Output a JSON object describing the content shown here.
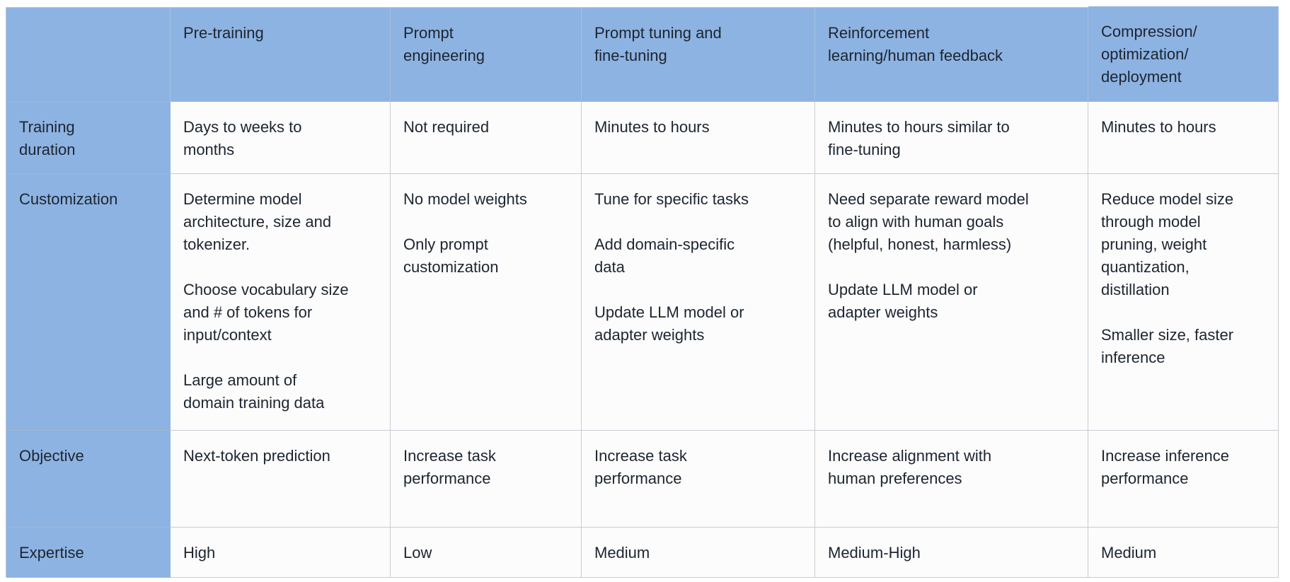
{
  "table": {
    "corner_label": "",
    "columns": [
      "Pre-training",
      "Prompt engineering",
      "Prompt tuning and fine-tuning",
      "Reinforcement learning/human feedback",
      "Compression/ optimization/ deployment"
    ],
    "column_lines": [
      [
        "Pre-training"
      ],
      [
        "Prompt",
        "engineering"
      ],
      [
        "Prompt tuning and",
        "fine-tuning"
      ],
      [
        "Reinforcement",
        "learning/human feedback"
      ],
      [
        "Compression/",
        "optimization/",
        "deployment"
      ]
    ],
    "rows": [
      {
        "label": "Training duration",
        "label_lines": [
          "Training",
          "duration"
        ],
        "cells": [
          [
            [
              "Days to weeks to",
              "months"
            ]
          ],
          [
            [
              "Not required"
            ]
          ],
          [
            [
              "Minutes to hours"
            ]
          ],
          [
            [
              "Minutes to hours similar to",
              "fine-tuning"
            ]
          ],
          [
            [
              "Minutes to hours"
            ]
          ]
        ]
      },
      {
        "label": "Customization",
        "label_lines": [
          "Customization"
        ],
        "cells": [
          [
            [
              "Determine model",
              "architecture, size and",
              "tokenizer."
            ],
            [
              "Choose vocabulary size",
              "and # of tokens for",
              "input/context"
            ],
            [
              "Large amount of",
              "domain training data"
            ]
          ],
          [
            [
              "No model weights"
            ],
            [
              "Only prompt",
              "customization"
            ]
          ],
          [
            [
              "Tune for specific tasks"
            ],
            [
              "Add domain-specific",
              "data"
            ],
            [
              "Update LLM model or",
              "adapter weights"
            ]
          ],
          [
            [
              "Need separate reward model",
              "to align with human goals",
              "(helpful, honest, harmless)"
            ],
            [
              "Update LLM model or",
              "adapter weights"
            ]
          ],
          [
            [
              "Reduce model size",
              "through model",
              "pruning, weight",
              "quantization,",
              "distillation"
            ],
            [
              "Smaller size, faster",
              "inference"
            ]
          ]
        ]
      },
      {
        "label": "Objective",
        "label_lines": [
          "Objective"
        ],
        "cells": [
          [
            [
              "Next-token prediction"
            ]
          ],
          [
            [
              "Increase task",
              "performance"
            ]
          ],
          [
            [
              "Increase task",
              "performance"
            ]
          ],
          [
            [
              "Increase alignment with",
              "human preferences"
            ]
          ],
          [
            [
              "Increase inference",
              "performance"
            ]
          ]
        ]
      },
      {
        "label": "Expertise",
        "label_lines": [
          "Expertise"
        ],
        "cells": [
          [
            [
              "High"
            ]
          ],
          [
            [
              "Low"
            ]
          ],
          [
            [
              "Medium"
            ]
          ],
          [
            [
              "Medium-High"
            ]
          ],
          [
            [
              "Medium"
            ]
          ]
        ]
      }
    ]
  },
  "colors": {
    "header_bg": "#8db3e2",
    "cell_bg": "#fdfcfc",
    "text": "#1c2530",
    "grid_line": "#c8ccd2"
  }
}
